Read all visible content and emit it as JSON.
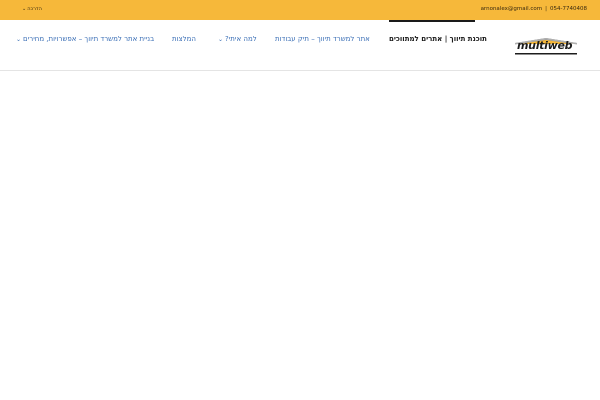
{
  "topbar": {
    "phone": "054-7740408",
    "separator": "|",
    "email": "arnonalex@gmail.com",
    "guide_label": "הדרכה",
    "guide_icon": "chevron-down-icon",
    "background": "#f6b83a"
  },
  "header": {
    "logo_text": "multiweb",
    "nav": [
      {
        "label": "תוכנת תיווך | אתרים למתווכים",
        "active": true
      },
      {
        "label": "אתר למשרד תיווך – תיק עבודות",
        "active": false
      },
      {
        "label": "למה איתי?",
        "active": false,
        "has_dropdown": true
      },
      {
        "label": "המלצות",
        "active": false
      },
      {
        "label": "בניית אתר למשרד תיווך – אפשרויות, מחירים",
        "active": false,
        "has_dropdown": true
      }
    ],
    "link_color": "#3b6fb6"
  }
}
